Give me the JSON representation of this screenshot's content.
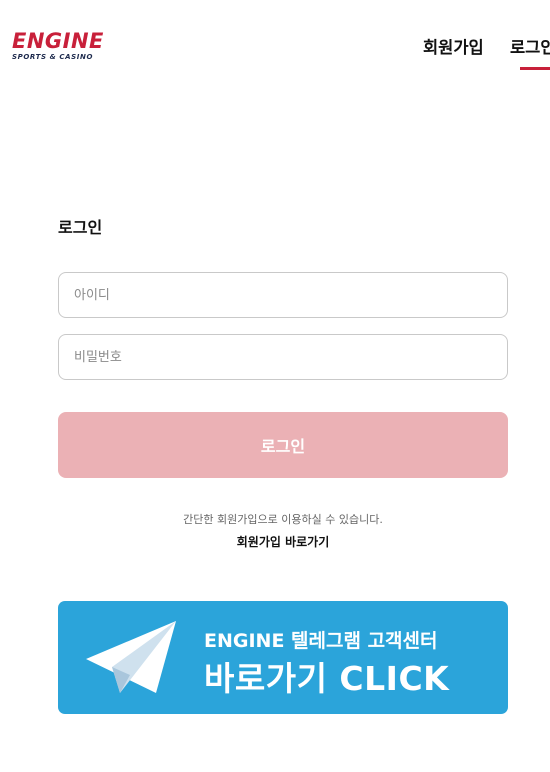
{
  "brand": {
    "name": "ENGINE",
    "tagline": "SPORTS & CASINO",
    "color": "#c8203a"
  },
  "nav": {
    "signup": "회원가입",
    "login": "로그인"
  },
  "form": {
    "title": "로그인",
    "id_placeholder": "아이디",
    "password_placeholder": "비밀번호",
    "submit_label": "로그인",
    "hint": "간단한 회원가입으로 이용하실 수 있습니다.",
    "signup_link": "회원가입 바로가기"
  },
  "banner": {
    "line1": "ENGINE 텔레그램 고객센터",
    "line2": "바로가기 CLICK",
    "icon": "telegram-plane-icon",
    "color": "#2ba4da"
  },
  "colors": {
    "accent": "#c8203a",
    "button_disabled": "#ebb1b5"
  }
}
